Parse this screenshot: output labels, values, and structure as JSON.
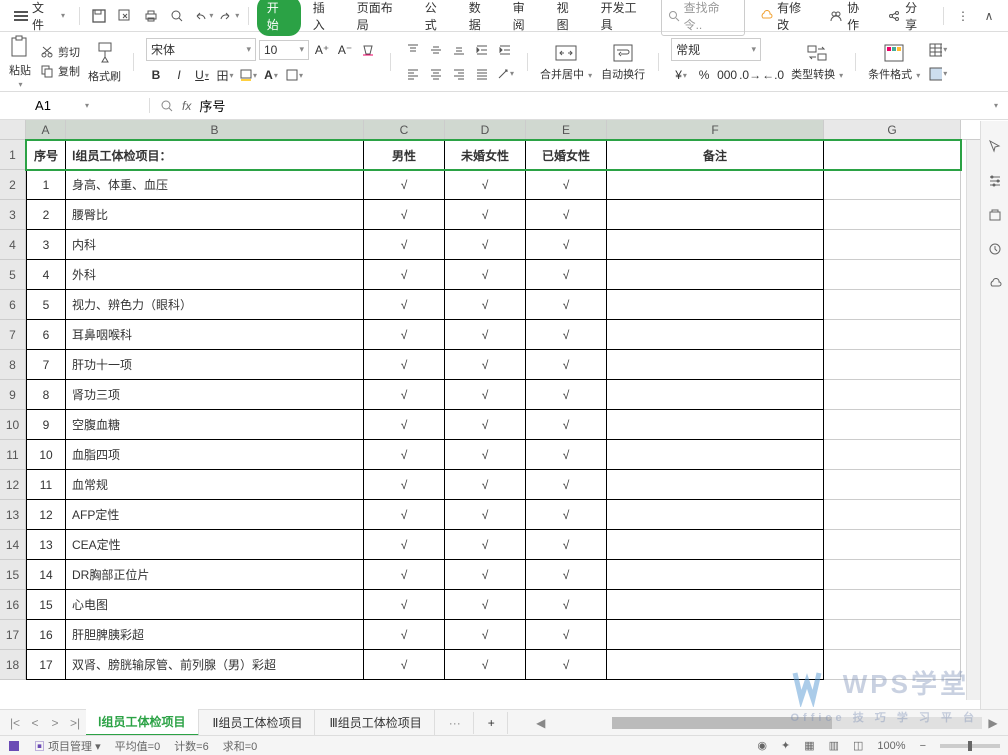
{
  "menu": {
    "file": "文件",
    "tabs": [
      "开始",
      "插入",
      "页面布局",
      "公式",
      "数据",
      "审阅",
      "视图",
      "开发工具"
    ],
    "search_placeholder": "查找命令..",
    "cloud_label": "有修改",
    "collab": "协作",
    "share": "分享"
  },
  "ribbon": {
    "paste": "粘贴",
    "cut": "剪切",
    "copy": "复制",
    "format_painter": "格式刷",
    "font_name": "宋体",
    "font_size": "10",
    "merge": "合并居中",
    "wrap": "自动换行",
    "number_format": "常规",
    "type_convert": "类型转换",
    "cond_format": "条件格式",
    "currency": "¥",
    "percent": "%"
  },
  "namebox": {
    "cell": "A1",
    "fx": "fx",
    "formula": "序号"
  },
  "cols": [
    "A",
    "B",
    "C",
    "D",
    "E",
    "F",
    "G"
  ],
  "header": {
    "seq": "序号",
    "project": "Ⅰ组员工体检项目：",
    "male": "男性",
    "female_unmarried": "未婚女性",
    "female_married": "已婚女性",
    "remark": "备注"
  },
  "rows": [
    {
      "n": "1",
      "item": "身高、体重、血压",
      "m": "√",
      "f1": "√",
      "f2": "√"
    },
    {
      "n": "2",
      "item": "腰臀比",
      "m": "√",
      "f1": "√",
      "f2": "√"
    },
    {
      "n": "3",
      "item": "内科",
      "m": "√",
      "f1": "√",
      "f2": "√"
    },
    {
      "n": "4",
      "item": "外科",
      "m": "√",
      "f1": "√",
      "f2": "√"
    },
    {
      "n": "5",
      "item": "视力、辨色力（眼科）",
      "m": "√",
      "f1": "√",
      "f2": "√"
    },
    {
      "n": "6",
      "item": "耳鼻咽喉科",
      "m": "√",
      "f1": "√",
      "f2": "√"
    },
    {
      "n": "7",
      "item": "肝功十一项",
      "m": "√",
      "f1": "√",
      "f2": "√"
    },
    {
      "n": "8",
      "item": "肾功三项",
      "m": "√",
      "f1": "√",
      "f2": "√"
    },
    {
      "n": "9",
      "item": "空腹血糖",
      "m": "√",
      "f1": "√",
      "f2": "√"
    },
    {
      "n": "10",
      "item": "血脂四项",
      "m": "√",
      "f1": "√",
      "f2": "√"
    },
    {
      "n": "11",
      "item": "血常规",
      "m": "√",
      "f1": "√",
      "f2": "√"
    },
    {
      "n": "12",
      "item": "AFP定性",
      "m": "√",
      "f1": "√",
      "f2": "√"
    },
    {
      "n": "13",
      "item": "CEA定性",
      "m": "√",
      "f1": "√",
      "f2": "√"
    },
    {
      "n": "14",
      "item": "DR胸部正位片",
      "m": "√",
      "f1": "√",
      "f2": "√"
    },
    {
      "n": "15",
      "item": "心电图",
      "m": "√",
      "f1": "√",
      "f2": "√"
    },
    {
      "n": "16",
      "item": "肝胆脾胰彩超",
      "m": "√",
      "f1": "√",
      "f2": "√"
    },
    {
      "n": "17",
      "item": "双肾、膀胱输尿管、前列腺（男）彩超",
      "m": "√",
      "f1": "√",
      "f2": "√"
    }
  ],
  "sheets": {
    "s1": "Ⅰ组员工体检项目",
    "s2": "Ⅱ组员工体检项目",
    "s3": "Ⅲ组员工体检项目",
    "add": "+"
  },
  "status": {
    "project": "项目管理",
    "avg": "平均值=0",
    "count": "计数=6",
    "sum": "求和=0",
    "zoom": "100%"
  },
  "watermark": "WPS学堂",
  "watermark_sub": "Office 技 巧 学 习 平 台"
}
